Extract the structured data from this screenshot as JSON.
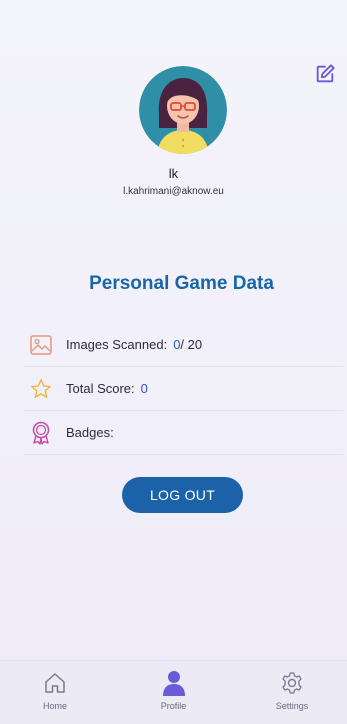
{
  "header": {
    "edit_icon": "edit-square-icon"
  },
  "profile": {
    "avatar_icon": "girl-with-glasses-avatar",
    "name": "lk",
    "email": "l.kahrimani@aknow.eu"
  },
  "section_title": "Personal Game Data",
  "stats": {
    "images_label": "Images Scanned:",
    "images_value": "0",
    "images_total": " / 20",
    "score_label": "Total Score:",
    "score_value": "0",
    "badges_label": "Badges:"
  },
  "logout_label": "LOG OUT",
  "nav": [
    {
      "label": "Home",
      "icon": "home-icon"
    },
    {
      "label": "Profile",
      "icon": "person-icon",
      "active": true
    },
    {
      "label": "Settings",
      "icon": "gear-icon"
    }
  ],
  "colors": {
    "accent": "#1a66a8",
    "value_blue": "#2d56c9",
    "active_nav": "#6a5bd8"
  }
}
